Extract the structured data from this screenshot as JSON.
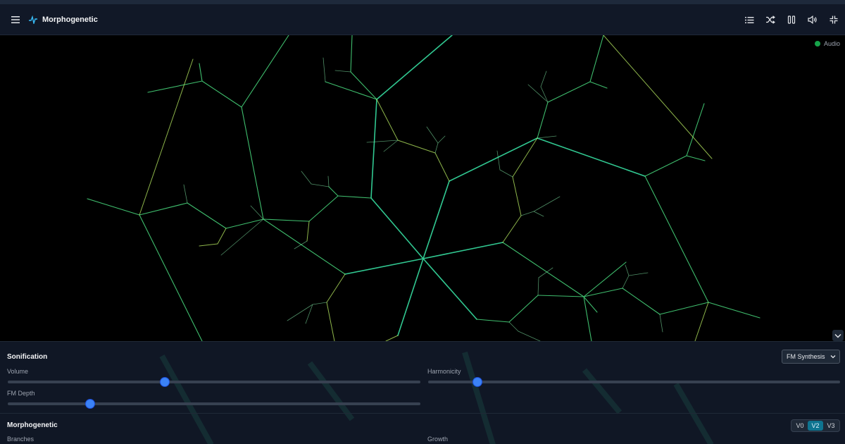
{
  "header": {
    "title": "Morphogenetic",
    "icons": [
      "menu-icon",
      "pulse-logo-icon",
      "list-icon",
      "shuffle-icon",
      "pause-icon",
      "volume-icon",
      "minimize-icon"
    ]
  },
  "canvas": {
    "audio_label": "Audio",
    "audio_status_color": "#16a34a",
    "branch_colors": [
      "#4ade80",
      "#bef264",
      "#34d399",
      "#a3e635"
    ]
  },
  "sonification": {
    "title": "Sonification",
    "mode_selected": "FM Synthesis",
    "sliders": [
      {
        "label": "Volume",
        "value": 0.38
      },
      {
        "label": "Harmonicity",
        "value": 0.12
      },
      {
        "label": "FM Depth",
        "value": 0.2
      }
    ]
  },
  "morphogenetic": {
    "title": "Morphogenetic",
    "versions": [
      "V0",
      "V2",
      "V3"
    ],
    "active_version": "V2",
    "labels": [
      "Branches",
      "Growth"
    ]
  },
  "colors": {
    "accent": "#3b82f6",
    "active_segment": "#0e7490",
    "background": "#000000",
    "header": "#111827"
  }
}
